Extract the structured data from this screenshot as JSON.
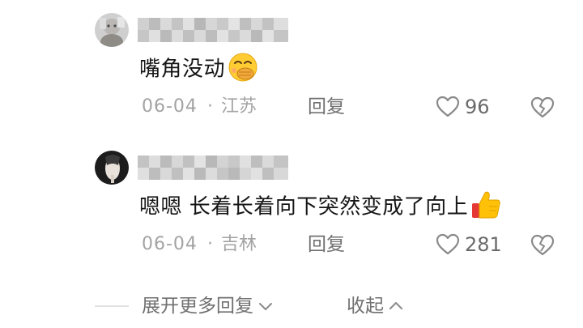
{
  "replies": [
    {
      "content": "嘴角没动",
      "emoji": "face-hand-over-mouth-emoji",
      "date": "06-04",
      "separator": "·",
      "location": "江苏",
      "reply_label": "回复",
      "likes": "96"
    },
    {
      "content": "嗯嗯 长着长着向下突然变成了向上",
      "emoji": "thumbs-up-emoji",
      "date": "06-04",
      "separator": "·",
      "location": "吉林",
      "reply_label": "回复",
      "likes": "281"
    }
  ],
  "footer": {
    "expand_label": "展开更多回复",
    "collapse_label": "收起"
  },
  "colors": {
    "meta_text": "#a3a3a3",
    "action_text": "#707070",
    "content_text": "#161616"
  }
}
